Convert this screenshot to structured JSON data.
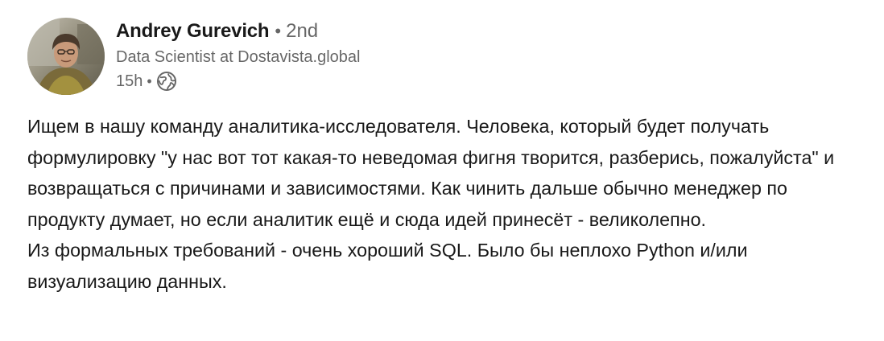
{
  "author": {
    "name": "Andrey Gurevich",
    "separator": "•",
    "connection_degree": "2nd",
    "headline": "Data Scientist at Dostavista.global",
    "posted_ago": "15h",
    "time_separator": "•",
    "visibility_icon": "globe-icon",
    "avatar_icon": "profile-photo"
  },
  "post": {
    "paragraphs": [
      "Ищем в нашу команду аналитика-исследователя. Человека, который будет получать формулировку \"у нас вот тот какая-то неведомая фигня творится, разберись, пожалуйста\" и возвращаться с причинами и зависимостями. Как чинить дальше обычно менеджер по продукту думает, но если аналитик ещё и сюда идей принесёт - великолепно.",
      "Из формальных требований - очень хороший SQL. Было бы неплохо Python и/или визуализацию данных."
    ]
  },
  "colors": {
    "text_primary": "#1a1a1a",
    "text_secondary": "#666666",
    "background": "#ffffff"
  }
}
